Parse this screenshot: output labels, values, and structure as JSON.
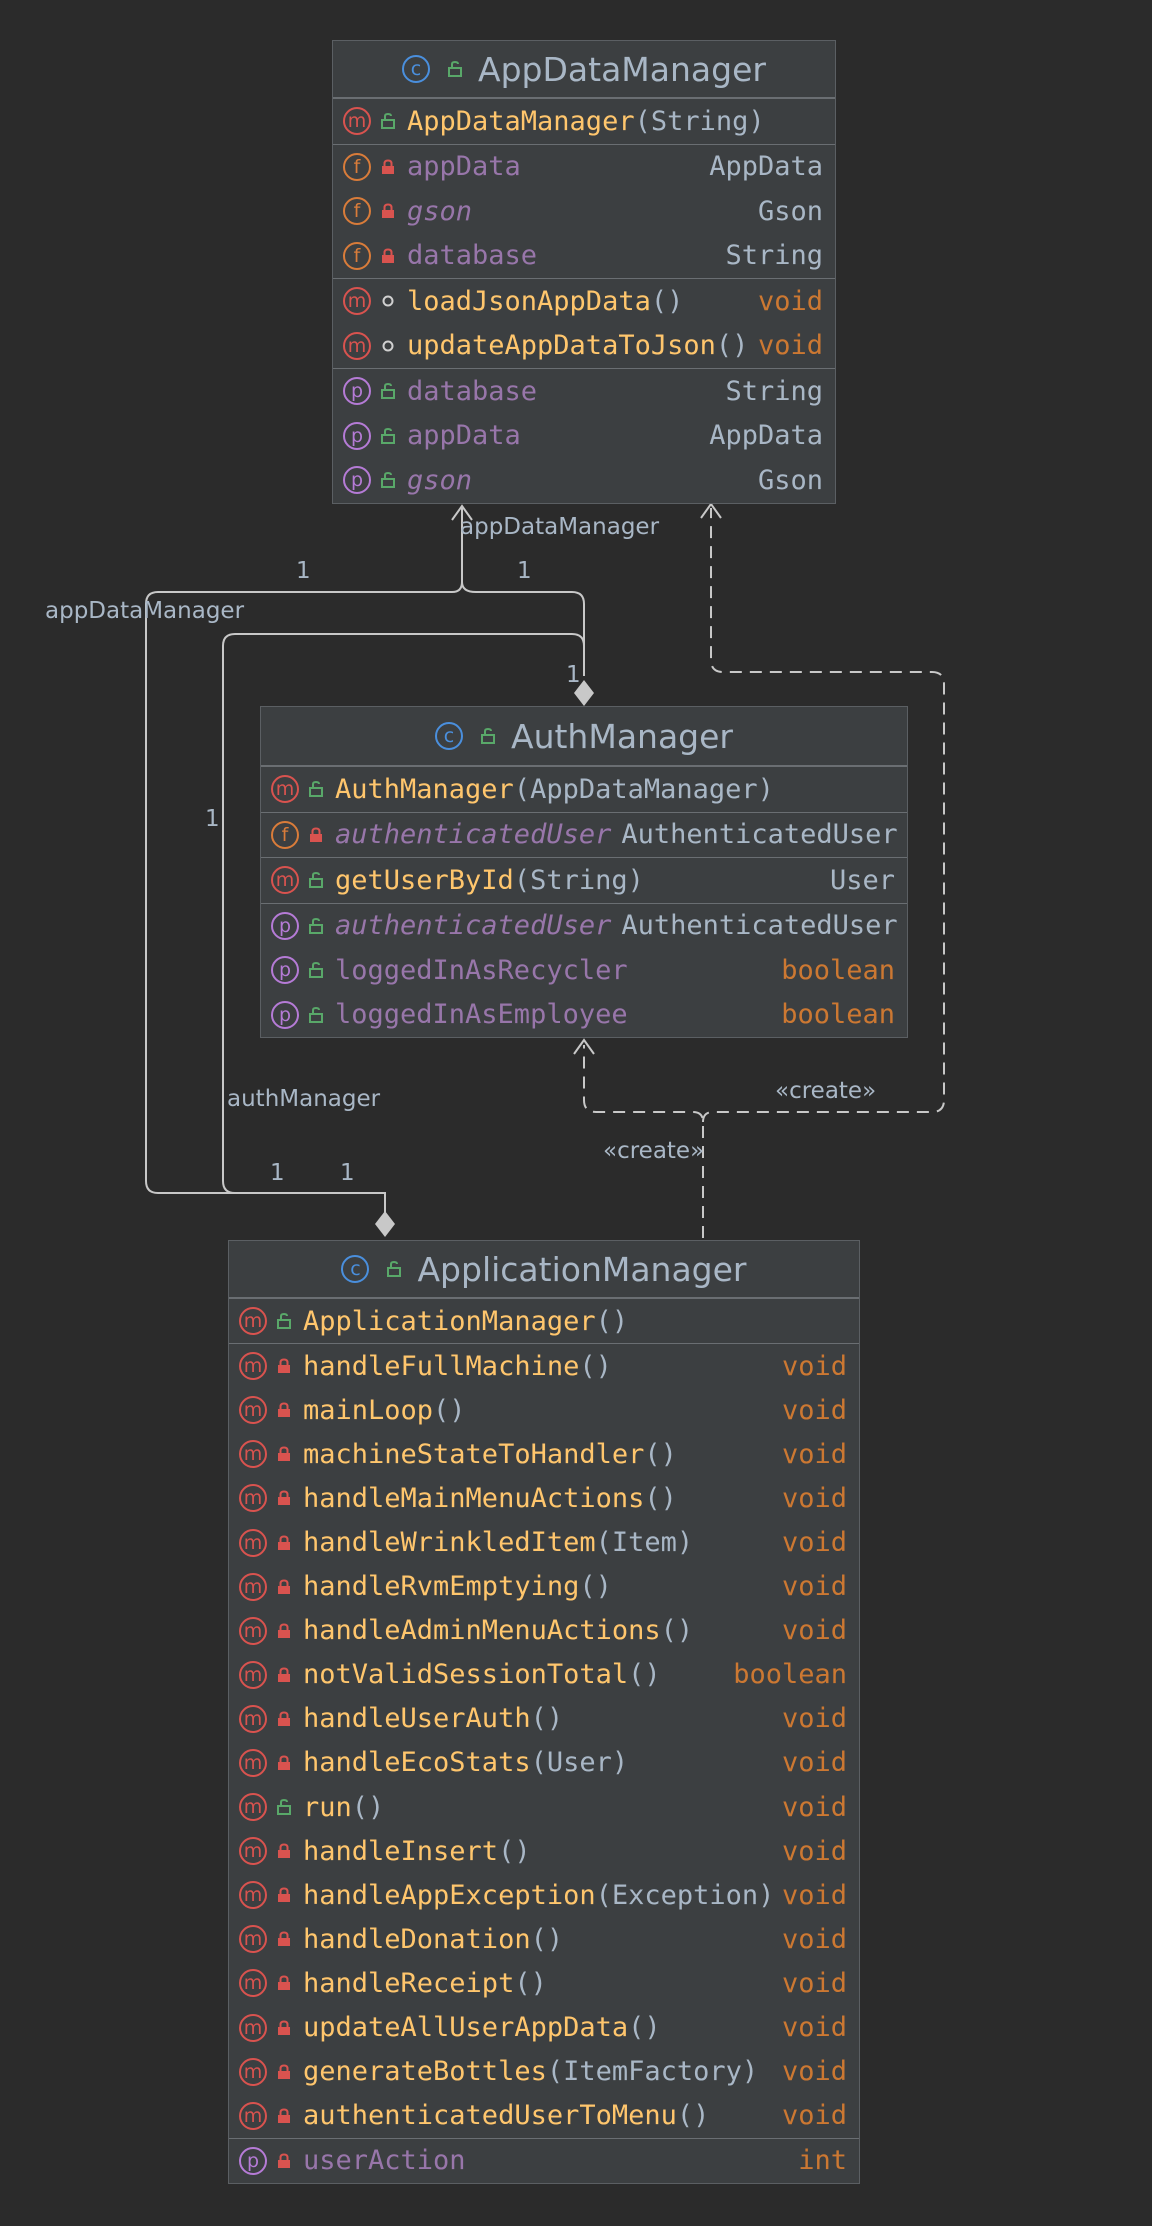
{
  "classes": {
    "appDataManager": {
      "name": "AppDataManager",
      "constructors": [
        {
          "name": "AppDataManager",
          "args": "(String)",
          "vis": "public"
        }
      ],
      "fields": [
        {
          "name": "appData",
          "type": "AppData",
          "italic": false
        },
        {
          "name": "gson",
          "type": "Gson",
          "italic": true
        },
        {
          "name": "database",
          "type": "String",
          "italic": false
        }
      ],
      "methods": [
        {
          "name": "loadJsonAppData",
          "args": "()",
          "type": "void",
          "vis": "package"
        },
        {
          "name": "updateAppDataToJson",
          "args": "()",
          "type": "void",
          "vis": "package"
        }
      ],
      "properties": [
        {
          "name": "database",
          "type": "String",
          "italic": false
        },
        {
          "name": "appData",
          "type": "AppData",
          "italic": false
        },
        {
          "name": "gson",
          "type": "Gson",
          "italic": true
        }
      ]
    },
    "authManager": {
      "name": "AuthManager",
      "constructors": [
        {
          "name": "AuthManager",
          "args": "(AppDataManager)"
        }
      ],
      "fields": [
        {
          "name": "authenticatedUser",
          "type": "AuthenticatedUser",
          "italic": true
        }
      ],
      "methods": [
        {
          "name": "getUserById",
          "args": "(String)",
          "type": "User"
        }
      ],
      "properties": [
        {
          "name": "authenticatedUser",
          "type": "AuthenticatedUser",
          "italic": true
        },
        {
          "name": "loggedInAsRecycler",
          "type": "boolean",
          "italic": false
        },
        {
          "name": "loggedInAsEmployee",
          "type": "boolean",
          "italic": false
        }
      ]
    },
    "applicationManager": {
      "name": "ApplicationManager",
      "constructors": [
        {
          "name": "ApplicationManager",
          "args": "()"
        }
      ],
      "methods": [
        {
          "name": "handleFullMachine",
          "args": "()",
          "type": "void",
          "vis": "private"
        },
        {
          "name": "mainLoop",
          "args": "()",
          "type": "void",
          "vis": "private"
        },
        {
          "name": "machineStateToHandler",
          "args": "()",
          "type": "void",
          "vis": "private"
        },
        {
          "name": "handleMainMenuActions",
          "args": "()",
          "type": "void",
          "vis": "private"
        },
        {
          "name": "handleWrinkledItem",
          "args": "(Item)",
          "type": "void",
          "vis": "private"
        },
        {
          "name": "handleRvmEmptying",
          "args": "()",
          "type": "void",
          "vis": "private"
        },
        {
          "name": "handleAdminMenuActions",
          "args": "()",
          "type": "void",
          "vis": "private"
        },
        {
          "name": "notValidSessionTotal",
          "args": "()",
          "type": "boolean",
          "vis": "private"
        },
        {
          "name": "handleUserAuth",
          "args": "()",
          "type": "void",
          "vis": "private"
        },
        {
          "name": "handleEcoStats",
          "args": "(User)",
          "type": "void",
          "vis": "private"
        },
        {
          "name": "run",
          "args": "()",
          "type": "void",
          "vis": "public"
        },
        {
          "name": "handleInsert",
          "args": "()",
          "type": "void",
          "vis": "private"
        },
        {
          "name": "handleAppException",
          "args": "(Exception)",
          "type": "void",
          "vis": "private"
        },
        {
          "name": "handleDonation",
          "args": "()",
          "type": "void",
          "vis": "private"
        },
        {
          "name": "handleReceipt",
          "args": "()",
          "type": "void",
          "vis": "private"
        },
        {
          "name": "updateAllUserAppData",
          "args": "()",
          "type": "void",
          "vis": "private"
        },
        {
          "name": "generateBottles",
          "args": "(ItemFactory)",
          "type": "void",
          "vis": "private"
        },
        {
          "name": "authenticatedUserToMenu",
          "args": "()",
          "type": "void",
          "vis": "private"
        }
      ],
      "properties": [
        {
          "name": "userAction",
          "type": "int"
        }
      ]
    }
  },
  "edge_labels": {
    "app_data_manager_top": "appDataManager",
    "app_data_manager_left": "appDataManager",
    "auth_manager": "authManager",
    "create_left": "«create»",
    "create_right": "«create»",
    "mult": [
      "1",
      "1",
      "1",
      "1",
      "1",
      "1"
    ]
  },
  "icons": {
    "class": "c",
    "method": "m",
    "field": "f",
    "property": "p"
  },
  "colors": {
    "background": "#2b2b2b",
    "class_bg": "#3c3f41",
    "method": "#ffc66d",
    "field": "#9876aa",
    "keyword": "#cc7832",
    "text": "#a9b7c6",
    "public": "#59a869",
    "private": "#d9534f"
  }
}
